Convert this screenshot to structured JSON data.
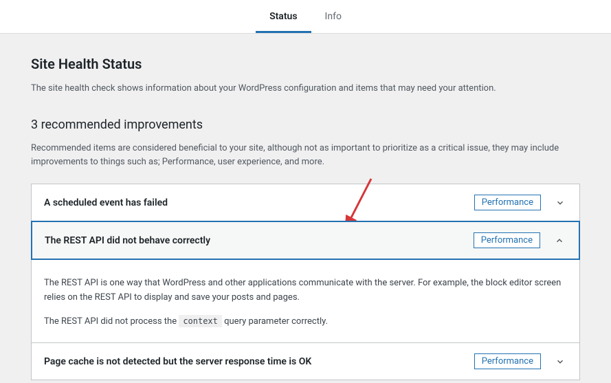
{
  "tabs": {
    "status": "Status",
    "info": "Info"
  },
  "page": {
    "title": "Site Health Status",
    "description": "The site health check shows information about your WordPress configuration and items that may need your attention."
  },
  "section": {
    "title": "3 recommended improvements",
    "description": "Recommended items are considered beneficial to your site, although not as important to prioritize as a critical issue, they may include improvements to things such as; Performance, user experience, and more."
  },
  "items": [
    {
      "title": "A scheduled event has failed",
      "badge": "Performance"
    },
    {
      "title": "The REST API did not behave correctly",
      "badge": "Performance",
      "body_p1": "The REST API is one way that WordPress and other applications communicate with the server. For example, the block editor screen relies on the REST API to display and save your posts and pages.",
      "body_p2_a": "The REST API did not process the ",
      "body_p2_code": "context",
      "body_p2_b": " query parameter correctly."
    },
    {
      "title": "Page cache is not detected but the server response time is OK",
      "badge": "Performance"
    }
  ]
}
